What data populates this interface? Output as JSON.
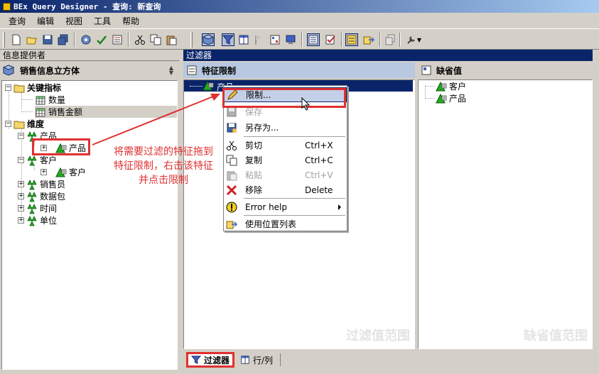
{
  "window": {
    "title": "BEx Query Designer - 查询: 新查询"
  },
  "menubar": {
    "items": [
      "查询",
      "编辑",
      "视图",
      "工具",
      "帮助"
    ]
  },
  "left_panel": {
    "header": "信息提供者",
    "provider": "销售信息立方体",
    "tree": {
      "key_figures": "关键指标",
      "kf_qty": "数量",
      "kf_amount": "销售金额",
      "dimensions": "维度",
      "dim_product": "产品",
      "char_product": "产品",
      "dim_customer": "客户",
      "char_customer": "客户",
      "dim_salesperson": "销售员",
      "dim_datapackage": "数据包",
      "dim_time": "时间",
      "dim_unit": "单位"
    }
  },
  "filter": {
    "header": "过滤器",
    "restrict_title": "特征限制",
    "restrict_item": "产品",
    "restrict_watermark": "过滤值范围",
    "default_title": "缺省值",
    "default_items": [
      "客户",
      "产品"
    ],
    "default_watermark": "缺省值范围"
  },
  "context_menu": {
    "items": [
      {
        "label": "限制...",
        "shortcut": ""
      },
      {
        "label": "保存",
        "shortcut": ""
      },
      {
        "label": "另存为...",
        "shortcut": ""
      },
      {
        "label": "剪切",
        "shortcut": "Ctrl+X"
      },
      {
        "label": "复制",
        "shortcut": "Ctrl+C"
      },
      {
        "label": "粘贴",
        "shortcut": "Ctrl+V"
      },
      {
        "label": "移除",
        "shortcut": "Delete"
      },
      {
        "label": "Error help",
        "shortcut": ""
      },
      {
        "label": "使用位置列表",
        "shortcut": ""
      }
    ]
  },
  "bottom_tabs": {
    "filter": "过滤器",
    "rowcol": "行/列"
  },
  "annotation": {
    "line1": "将需要过滤的特征拖到",
    "line2": "特征限制，右击该特征",
    "line3": "并点击限制"
  },
  "colors": {
    "accent_red": "#e03030",
    "selection_blue": "#0a246a",
    "char_green": "#1a9a1a"
  }
}
